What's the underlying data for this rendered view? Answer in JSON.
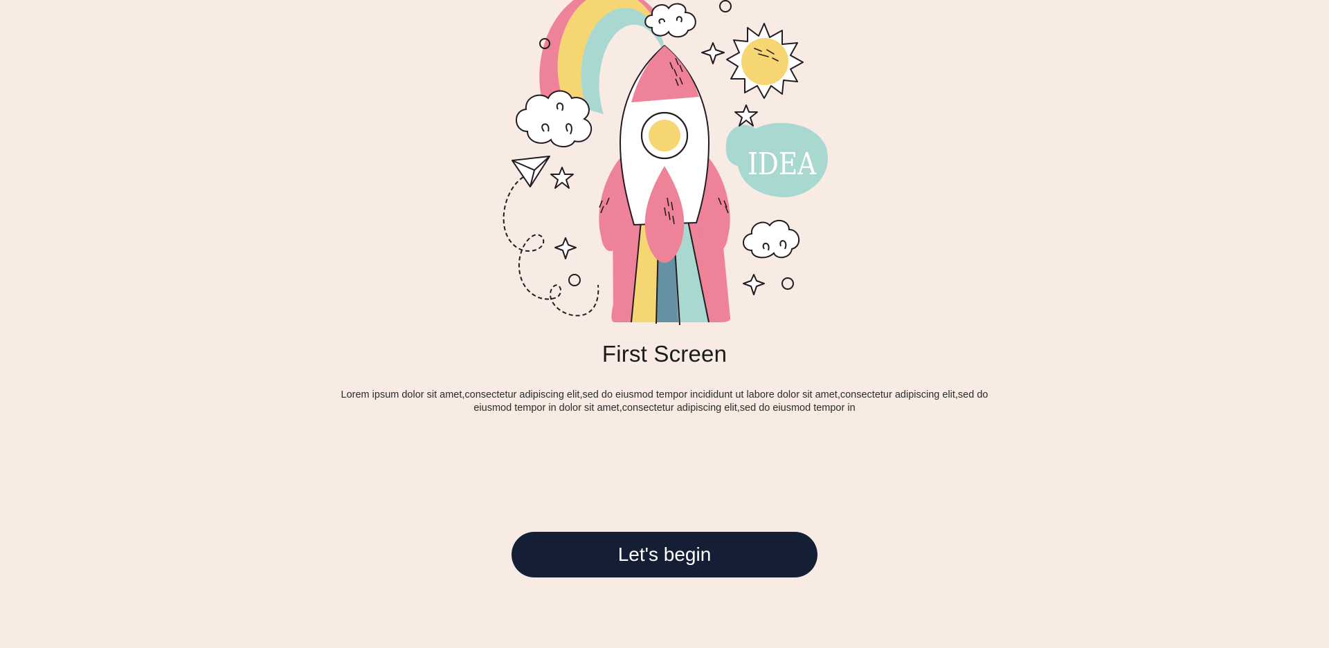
{
  "screen": {
    "title": "First Screen",
    "description": "Lorem ipsum dolor sit amet,consectetur adipiscing elit,sed do eiusmod tempor incididunt ut labore  dolor sit amet,consectetur adipiscing elit,sed do eiusmod tempor in  dolor sit amet,consectetur adipiscing elit,sed do eiusmod tempor in",
    "cta_label": "Let's begin"
  },
  "illustration": {
    "bubble_text": "IDEA",
    "icons": [
      "rocket-icon",
      "rainbow-icon",
      "sun-icon",
      "cloud-icon",
      "star-icon",
      "sparkle-icon",
      "paper-plane-icon",
      "speech-bubble-icon"
    ]
  },
  "colors": {
    "background": "#f7ebe3",
    "button": "#141f36",
    "pink": "#ee8298",
    "yellow": "#f6d673",
    "mint": "#a8d8cf",
    "steel_blue": "#6592a2",
    "outline": "#231a22"
  }
}
